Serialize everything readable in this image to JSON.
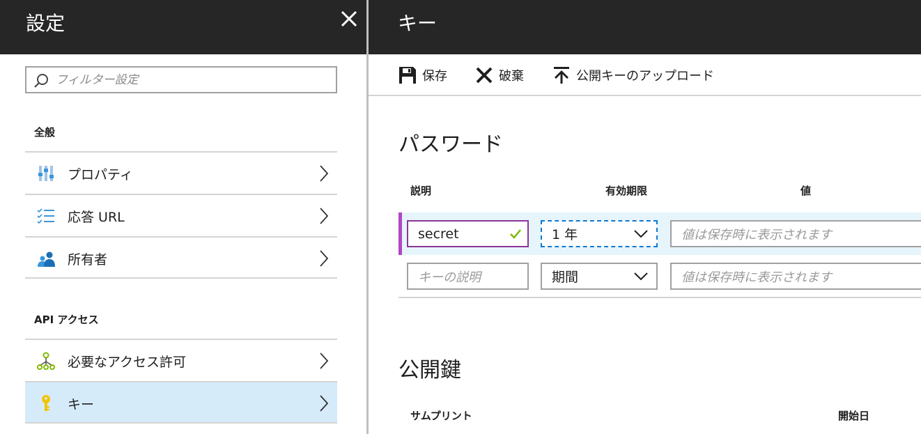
{
  "left_blade": {
    "title": "設定",
    "filter_placeholder": "フィルター設定",
    "section_general": "全般",
    "general_items": [
      {
        "label": "プロパティ",
        "icon": "properties-icon"
      },
      {
        "label": "応答 URL",
        "icon": "checklist-icon"
      },
      {
        "label": "所有者",
        "icon": "owners-icon"
      }
    ],
    "section_api": "API アクセス",
    "api_items": [
      {
        "label": "必要なアクセス許可",
        "icon": "permissions-icon"
      },
      {
        "label": "キー",
        "icon": "key-icon",
        "active": true
      }
    ]
  },
  "right_blade": {
    "title": "キー",
    "commands": {
      "save": "保存",
      "discard": "破棄",
      "upload": "公開キーのアップロード"
    },
    "passwords_heading": "パスワード",
    "columns": {
      "description": "説明",
      "expires": "有効期限",
      "value": "値"
    },
    "rows": [
      {
        "description": "secret",
        "expires": "1 年",
        "value_placeholder": "値は保存時に表示されます"
      },
      {
        "description_placeholder": "キーの説明",
        "expires": "期間",
        "value_placeholder": "値は保存時に表示されます"
      }
    ],
    "public_keys_heading": "公開鍵",
    "pk_columns": {
      "thumbprint": "サムプリント",
      "start_date": "開始日"
    }
  },
  "colors": {
    "header_bg": "#262626",
    "active_item_bg": "#d6ebfa",
    "selected_row_bg": "#e6f4fb",
    "selected_row_marker": "#b146c2",
    "check_green": "#7fba00",
    "icon_blue": "#3a96dd",
    "icon_green": "#7fba00",
    "icon_yellow": "#f2c400"
  }
}
